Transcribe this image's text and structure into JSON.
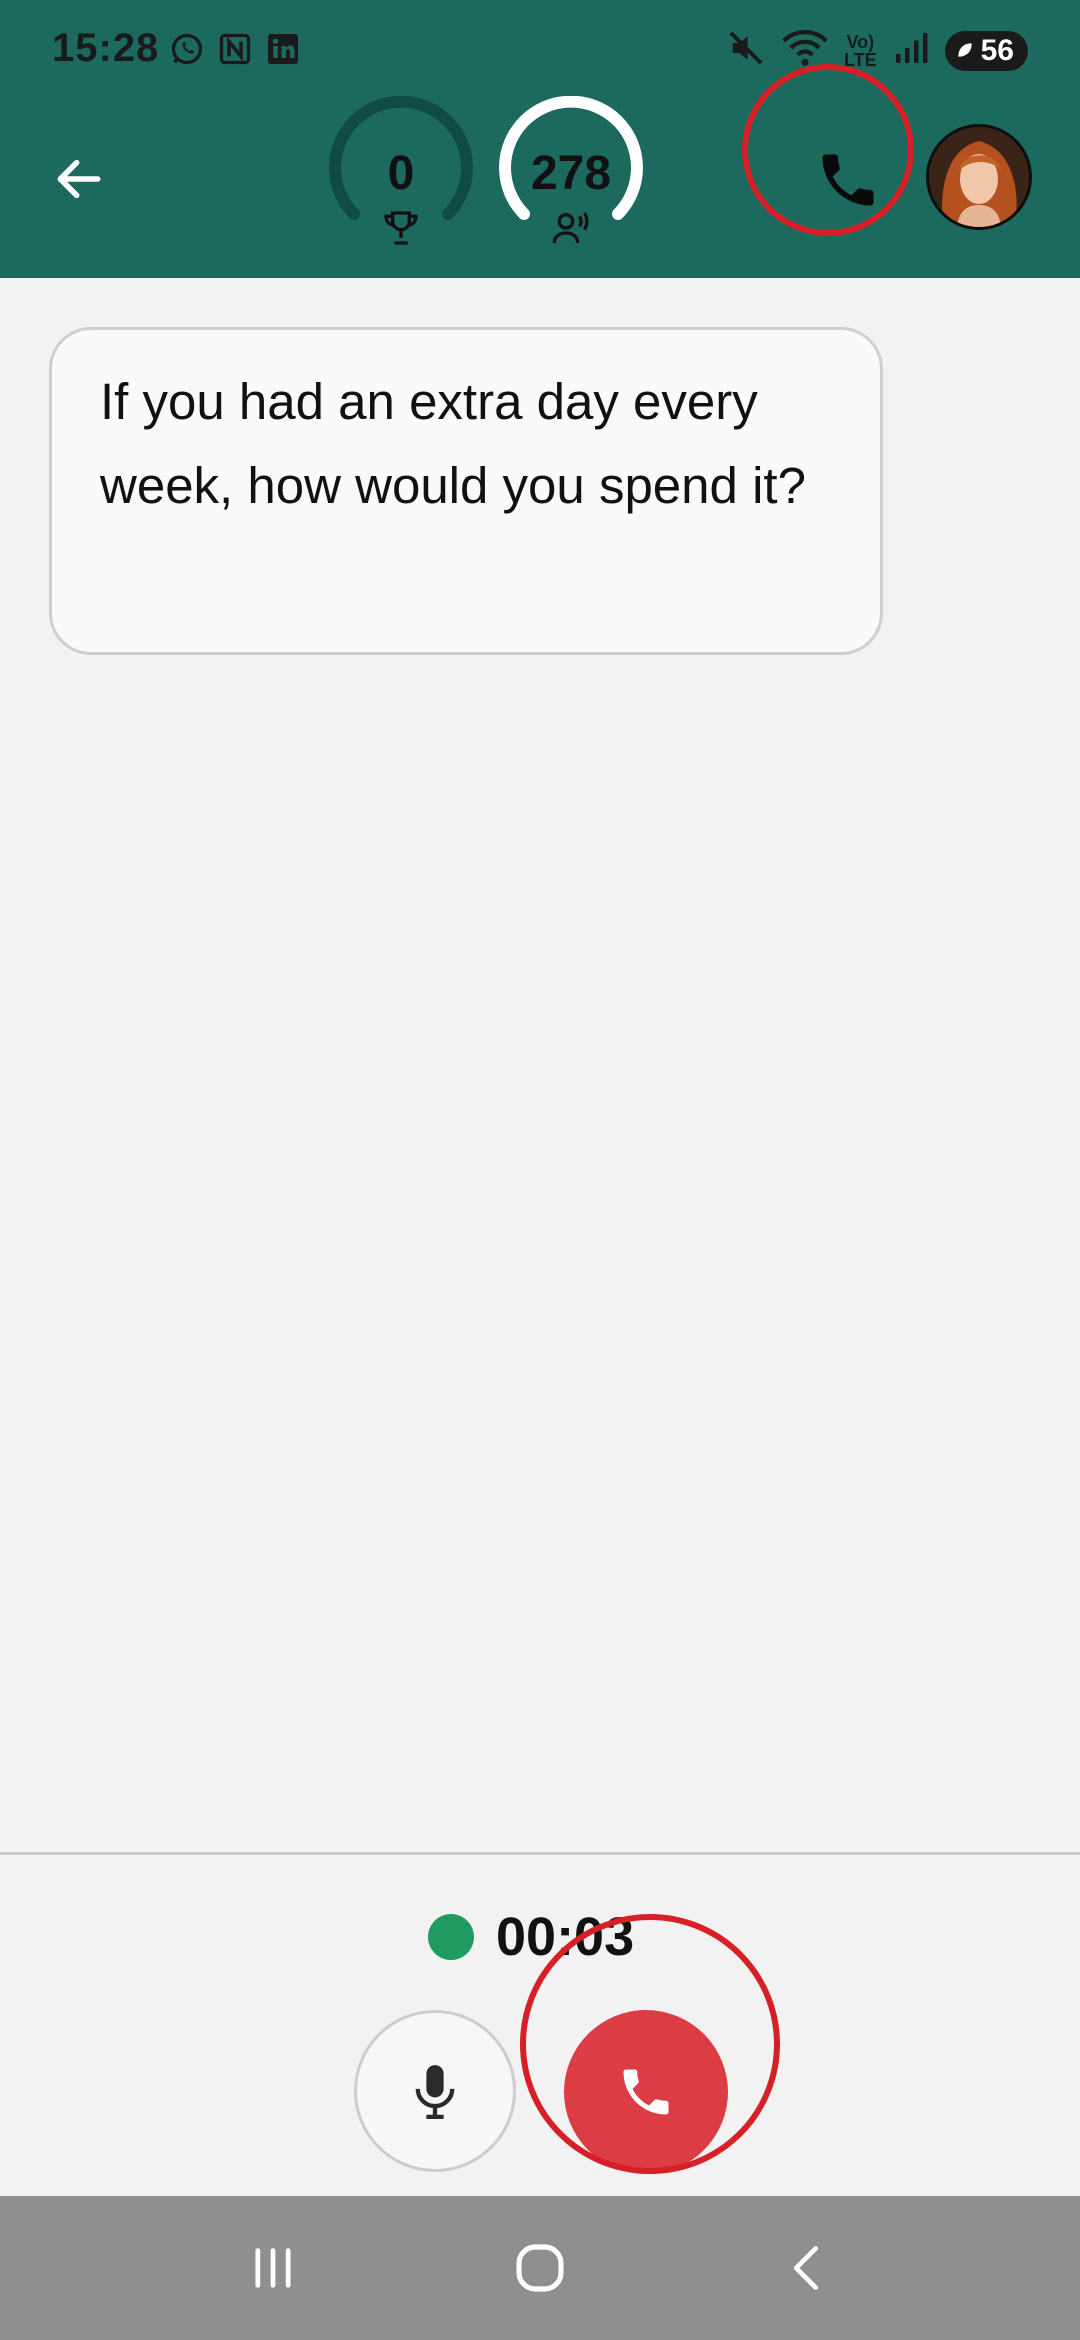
{
  "status_bar": {
    "time": "15:28",
    "app_icons": [
      "whatsapp-icon",
      "notion-icon",
      "linkedin-icon"
    ],
    "network": "Vo) LTE",
    "network_line1": "Vo)",
    "network_line2": "LTE",
    "battery": "56"
  },
  "header": {
    "score": "0",
    "score_icon": "trophy-icon",
    "listen_count": "278",
    "listen_icon": "speaking-person-icon",
    "score_gauge_fraction": 0.0,
    "listen_gauge_fraction": 1.0,
    "colors": {
      "background": "#1c6a5d",
      "gauge_track": "#104c43",
      "gauge_fill": "#ffffff"
    }
  },
  "message": {
    "text": "If you had an extra day every week, how would you spend it?"
  },
  "call": {
    "timer": "00:03",
    "status_color": "#1f9a60",
    "end_color": "#dc3d45"
  },
  "annotations": {
    "color": "#d61f26",
    "targets": [
      "call-button",
      "end-call-button"
    ]
  }
}
